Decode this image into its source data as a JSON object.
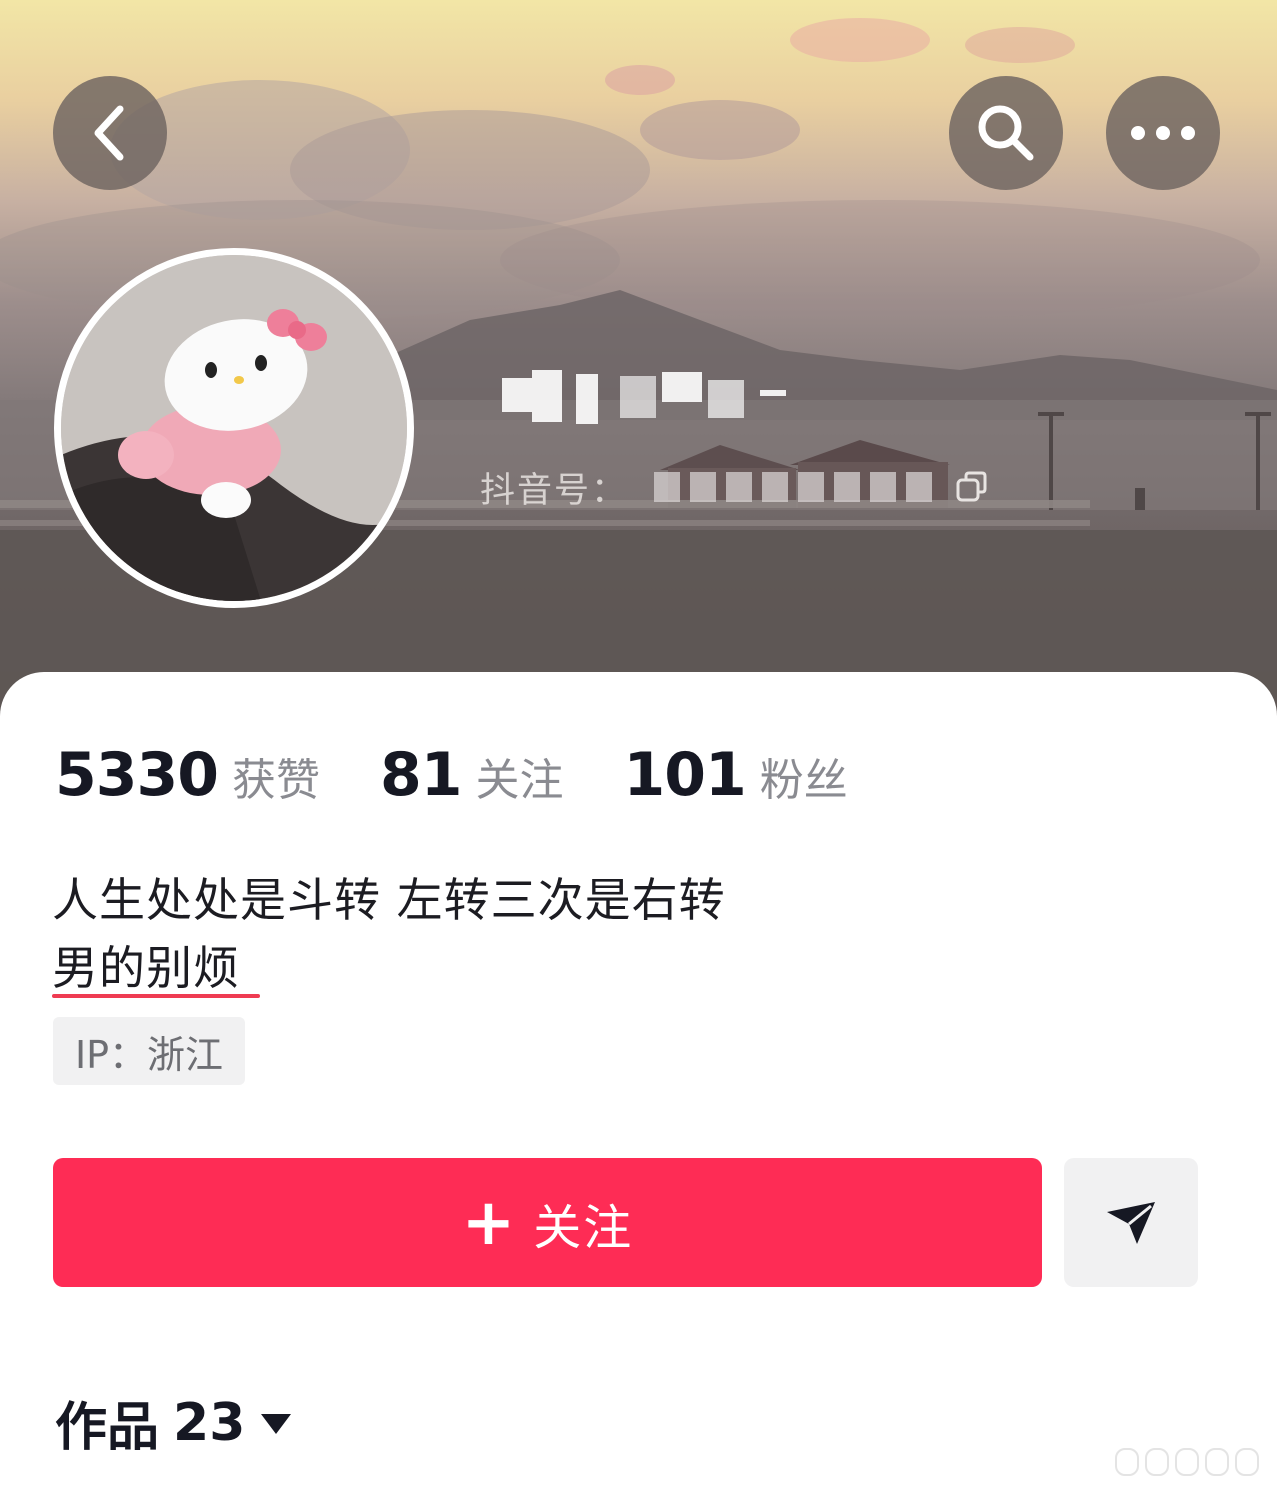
{
  "header": {
    "back_icon": "chevron-left-icon",
    "search_icon": "search-icon",
    "more_icon": "more-dots-icon",
    "douyin_id_label": "抖音号：",
    "copy_icon": "copy-icon"
  },
  "stats": [
    {
      "value": "5330",
      "label": "获赞"
    },
    {
      "value": "81",
      "label": "关注"
    },
    {
      "value": "101",
      "label": "粉丝"
    }
  ],
  "bio": {
    "line1": "人生处处是斗转 左转三次是右转",
    "line2": "男的别烦"
  },
  "ip_tag": "IP：浙江",
  "actions": {
    "follow_label": "关注",
    "follow_plus": "+",
    "message_icon": "send-icon",
    "accent_color": "#fe2c55"
  },
  "works_tab": {
    "label": "作品",
    "count": "23",
    "caret_icon": "caret-down-icon"
  }
}
